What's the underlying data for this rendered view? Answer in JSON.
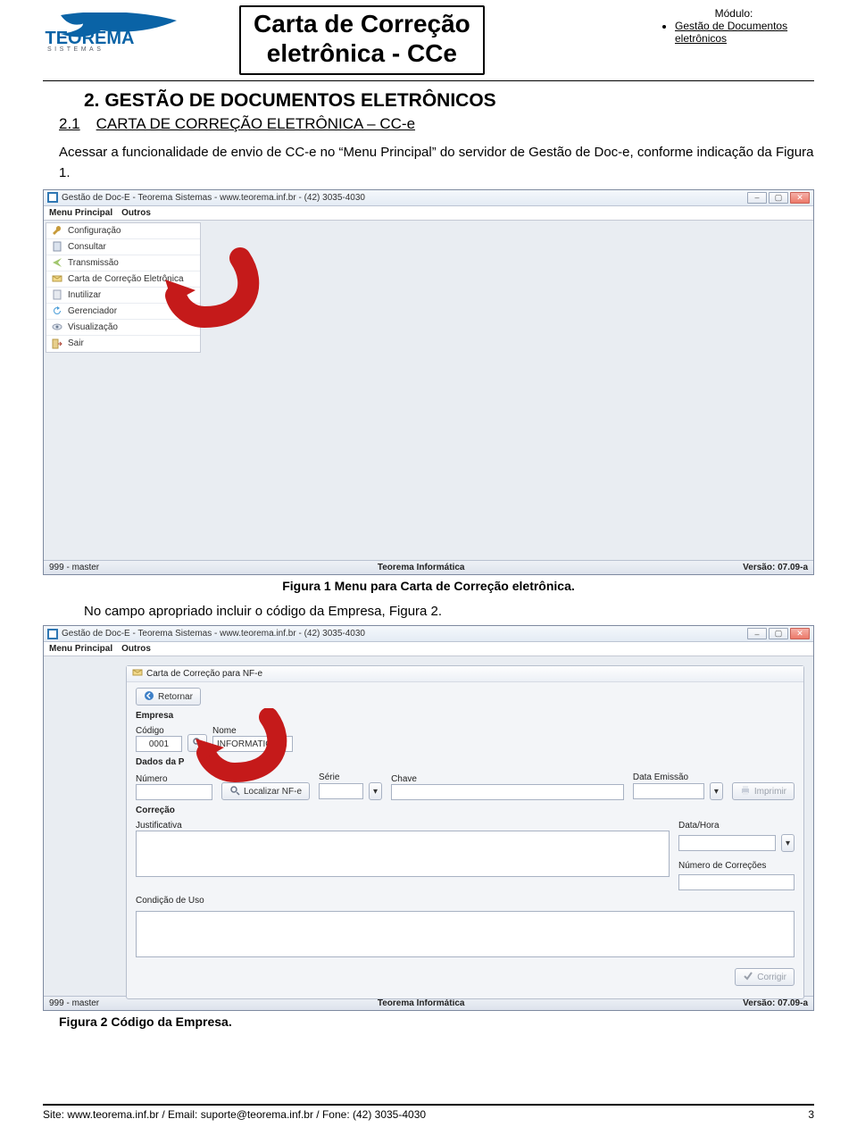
{
  "header": {
    "logo_brand": "TEOREMA",
    "logo_sub": "S I S T E M A S",
    "title_line1": "Carta de Correção",
    "title_line2": "eletrônica - CCe",
    "module_label": "Módulo:",
    "module_item": "Gestão de Documentos eletrônicos"
  },
  "section": {
    "heading": "2. GESTÃO DE DOCUMENTOS ELETRÔNICOS",
    "sub_num": "2.1",
    "sub_title": "CARTA DE CORREÇÃO ELETRÔNICA – CC-e",
    "intro": "Acessar a funcionalidade de envio de CC-e no “Menu Principal” do servidor de Gestão de Doc-e, conforme indicação da Figura 1."
  },
  "shot1": {
    "title": "Gestão de Doc-E - Teorema Sistemas - www.teorema.inf.br - (42) 3035-4030",
    "menu1": "Menu Principal",
    "menu2": "Outros",
    "items": [
      "Configuração",
      "Consultar",
      "Transmissão",
      "Carta de Correção Eletrônica",
      "Inutilizar",
      "Gerenciador",
      "Visualização",
      "Sair"
    ],
    "status_left": "999  -  master",
    "status_center": "Teorema Informática",
    "status_right": "Versão: 07.09-a"
  },
  "caption1": "Figura 1 Menu para Carta de  Correção eletrônica.",
  "mid_text": "No campo apropriado incluir o código da Empresa, Figura 2.",
  "shot2": {
    "title": "Gestão de Doc-E - Teorema Sistemas - www.teorema.inf.br - (42) 3035-4030",
    "menu1": "Menu Principal",
    "menu2": "Outros",
    "dlg_title": "Carta de Correção para NF-e",
    "retornar": "Retornar",
    "empresa": "Empresa",
    "codigo_lbl": "Código",
    "codigo_val": "0001",
    "nome_lbl": "Nome",
    "nome_val": "INFORMATICA",
    "dados": "Dados da P",
    "numero_lbl": "Número",
    "localizar": "Localizar NF-e",
    "serie_lbl": "Série",
    "chave_lbl": "Chave",
    "data_emissao_lbl": "Data Emissão",
    "imprimir": "Imprimir",
    "correcao": "Correção",
    "justificativa_lbl": "Justificativa",
    "data_hora_lbl": "Data/Hora",
    "num_corr_lbl": "Número de Correções",
    "cond_uso_lbl": "Condição de Uso",
    "corrigir": "Corrigir",
    "status_left": "999  -  master",
    "status_center": "Teorema Informática",
    "status_right": "Versão: 07.09-a"
  },
  "caption2": "Figura 2 Código da Empresa.",
  "footer": {
    "text": "Site: www.teorema.inf.br / Email: suporte@teorema.inf.br / Fone: (42) 3035-4030",
    "page": "3"
  }
}
